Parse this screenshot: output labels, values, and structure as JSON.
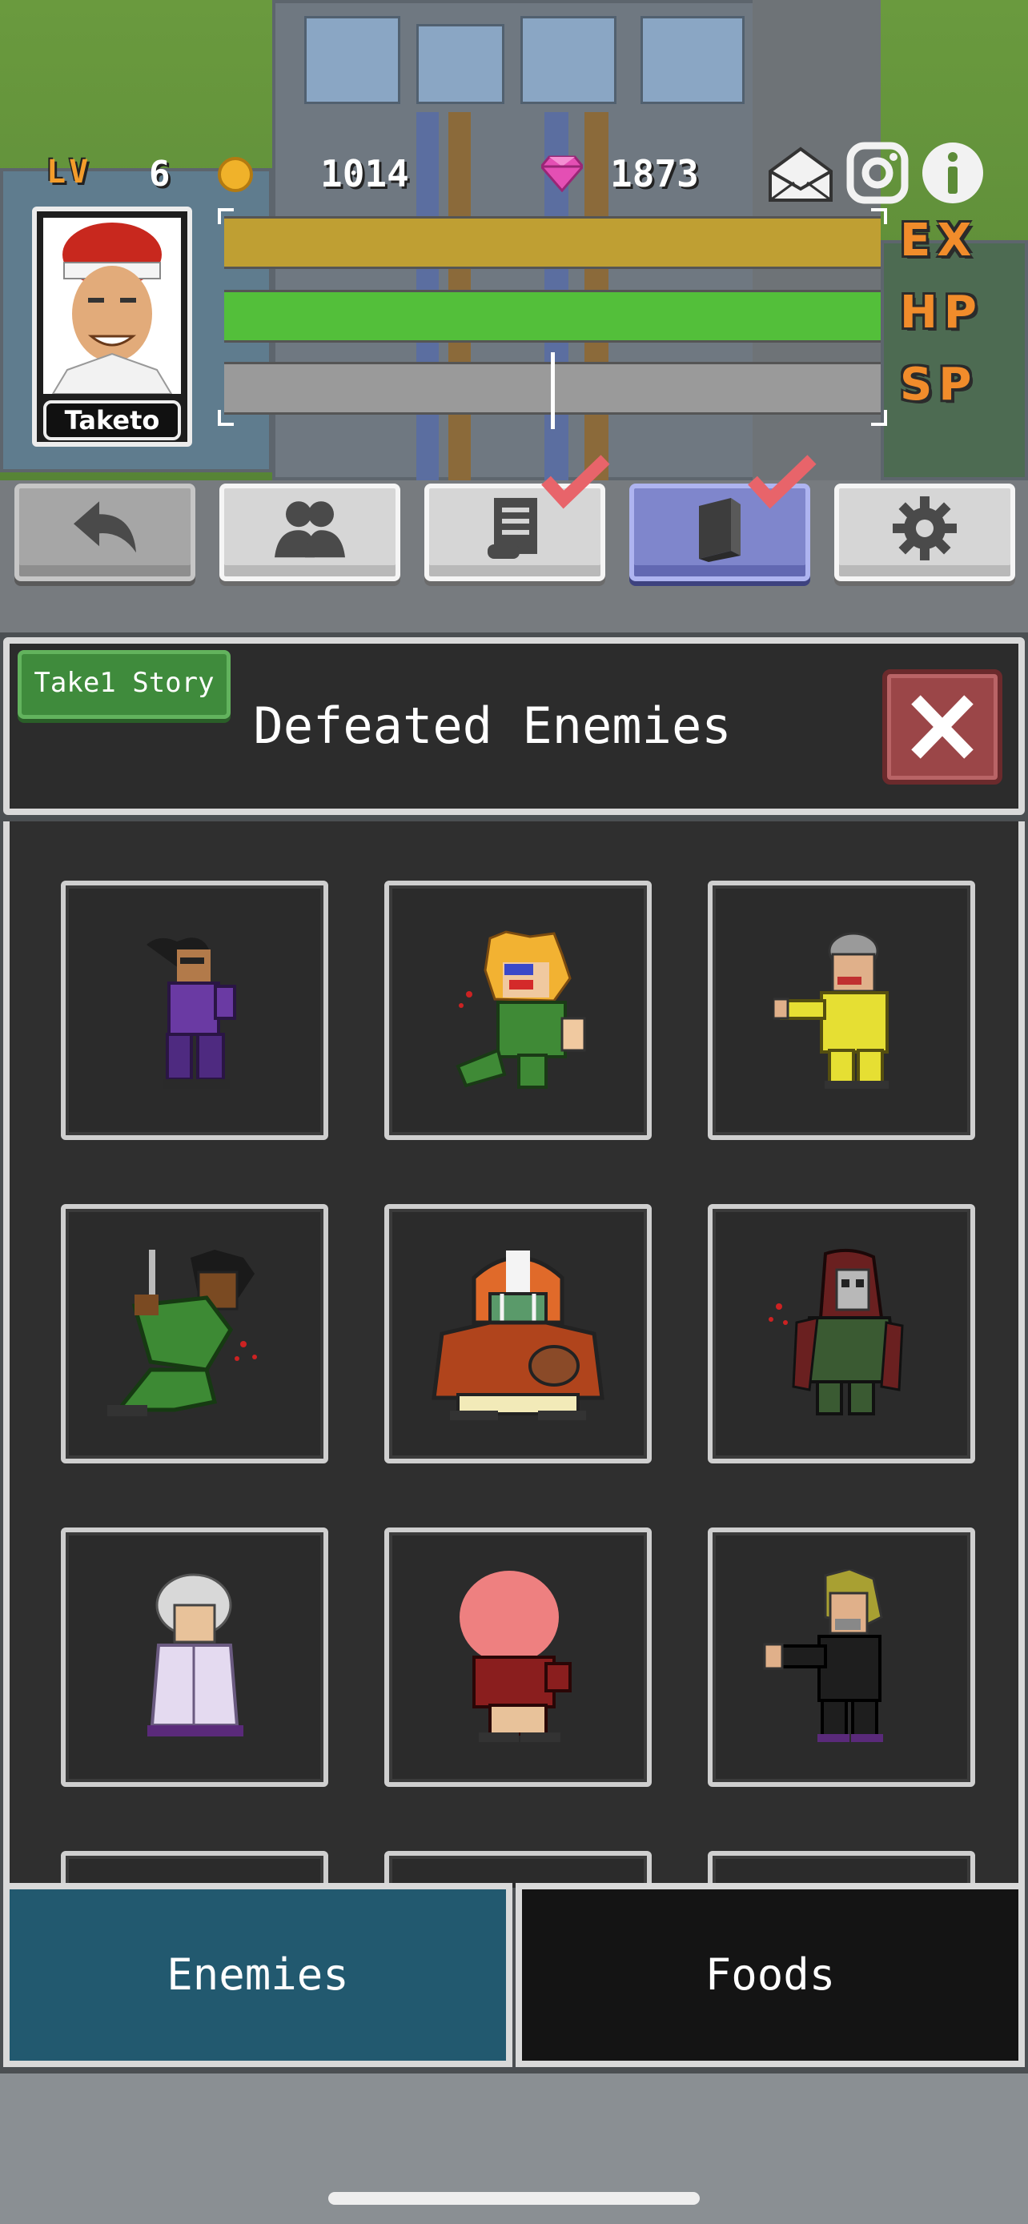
{
  "hud": {
    "level_label": "LV",
    "level": "6",
    "coins": "1014",
    "gems": "1873",
    "icons": [
      "mail-icon",
      "instagram-icon",
      "info-icon"
    ]
  },
  "player": {
    "name": "Taketo"
  },
  "bars": {
    "ex": {
      "label": "EX",
      "fill": 1.0,
      "color": "#bf9f33"
    },
    "hp": {
      "label": "HP",
      "fill": 1.0,
      "color": "#53bf3a"
    },
    "sp": {
      "label": "SP",
      "fill": 1.0,
      "color": "#9a9a9a"
    }
  },
  "menu": [
    {
      "name": "back-button",
      "icon": "back-arrow-icon"
    },
    {
      "name": "party-button",
      "icon": "people-icon"
    },
    {
      "name": "quest-button",
      "icon": "scroll-icon",
      "checked": true
    },
    {
      "name": "book-button",
      "icon": "book-icon",
      "checked": true,
      "active": true
    },
    {
      "name": "settings-button",
      "icon": "gear-icon"
    }
  ],
  "panel": {
    "badge": "Take1 Story",
    "title": "Defeated Enemies"
  },
  "enemies": [
    "enemy-ponytail-purple",
    "enemy-blonde-green",
    "enemy-grey-yellow",
    "enemy-dreadlocks-green",
    "enemy-football-helmet",
    "enemy-hooded-skull",
    "enemy-white-hair-robe",
    "enemy-pink-head",
    "enemy-blonde-black-suit"
  ],
  "tabs": {
    "enemies": "Enemies",
    "foods": "Foods"
  },
  "colors": {
    "active_tab": "#22596f",
    "inactive_tab": "#141414",
    "close_button": "#9b4648",
    "story_badge": "#3f8b3c",
    "active_menu": "#7f86cc"
  }
}
